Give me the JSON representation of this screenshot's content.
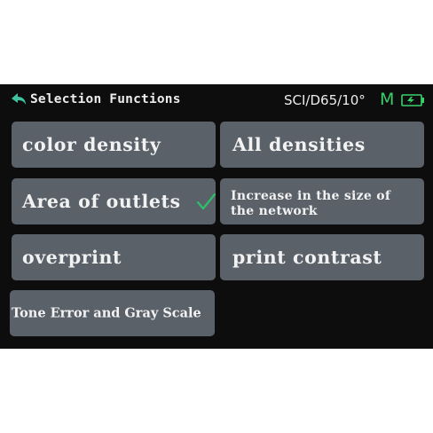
{
  "header": {
    "title": "Selection Functions",
    "mode": "SCI/D65/10°",
    "indicator": "M",
    "back_icon": "back-arrow-icon",
    "battery_icon": "battery-charging-icon"
  },
  "buttons": [
    {
      "label": "color density"
    },
    {
      "label": "All densities"
    },
    {
      "label": "Area of outlets",
      "selected": true
    },
    {
      "label": "Increase in the size of the network"
    },
    {
      "label": "overprint"
    },
    {
      "label": "print contrast"
    },
    {
      "label": "Tone Error and Gray Scale"
    }
  ],
  "colors": {
    "screen_bg": "#0d0d0d",
    "button_bg": "#5a6169",
    "text": "#f2f2f2",
    "accent_green": "#39d06b",
    "check_green": "#2fbf6a"
  }
}
